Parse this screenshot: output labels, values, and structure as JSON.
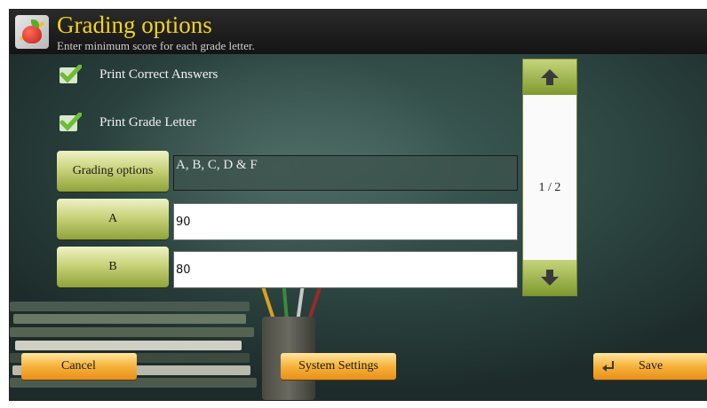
{
  "header": {
    "title": "Grading options",
    "subtitle": "Enter minimum score for each grade letter."
  },
  "options": {
    "print_correct_answers": {
      "label": "Print Correct Answers",
      "checked": true
    },
    "print_grade_letter": {
      "label": "Print Grade Letter",
      "checked": true
    }
  },
  "grading": {
    "button_label": "Grading options",
    "value": "A, B, C, D & F"
  },
  "grades": [
    {
      "letter": "A",
      "score": "90"
    },
    {
      "letter": "B",
      "score": "80"
    }
  ],
  "pager": {
    "text": "1 / 2"
  },
  "footer": {
    "cancel_label": "Cancel",
    "system_settings_label": "System Settings",
    "save_label": "Save"
  },
  "colors": {
    "title": "#f3d31e",
    "check": "#7ec84a",
    "grade_button": "#c9d37a",
    "footer_button": "#f7b23a"
  },
  "icons": [
    "app-icon",
    "checkmark-icon",
    "arrow-up-icon",
    "arrow-down-icon",
    "return-arrow-icon"
  ]
}
